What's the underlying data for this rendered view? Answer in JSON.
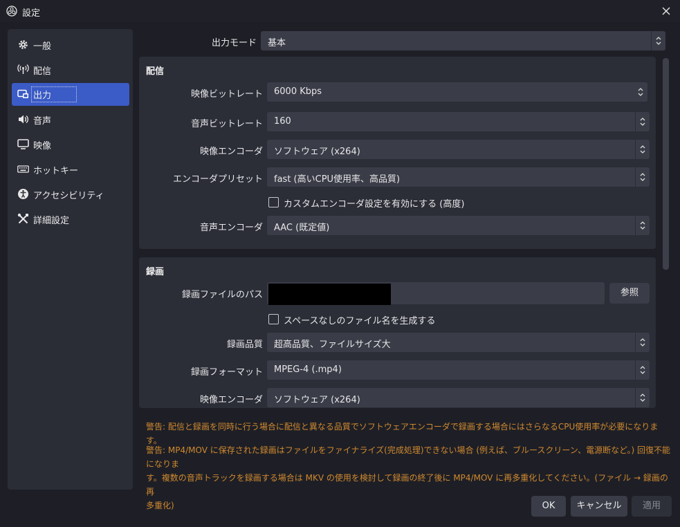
{
  "window": {
    "title": "設定"
  },
  "sidebar": {
    "items": [
      {
        "label": "一般",
        "icon": "gear-icon"
      },
      {
        "label": "配信",
        "icon": "broadcast-icon"
      },
      {
        "label": "出力",
        "icon": "output-icon"
      },
      {
        "label": "音声",
        "icon": "speaker-icon"
      },
      {
        "label": "映像",
        "icon": "monitor-icon"
      },
      {
        "label": "ホットキー",
        "icon": "keyboard-icon"
      },
      {
        "label": "アクセシビリティ",
        "icon": "accessibility-icon"
      },
      {
        "label": "詳細設定",
        "icon": "tools-icon"
      }
    ]
  },
  "output_mode": {
    "label": "出力モード",
    "value": "基本"
  },
  "streaming": {
    "title": "配信",
    "video_bitrate": {
      "label": "映像ビットレート",
      "value": "6000 Kbps"
    },
    "audio_bitrate": {
      "label": "音声ビットレート",
      "value": "160"
    },
    "video_encoder": {
      "label": "映像エンコーダ",
      "value": "ソフトウェア (x264)"
    },
    "encoder_preset": {
      "label": "エンコーダプリセット",
      "value": "fast (高いCPU使用率、高品質)"
    },
    "custom_encoder_checkbox": {
      "label": "カスタムエンコーダ設定を有効にする (高度)",
      "checked": false
    },
    "audio_encoder": {
      "label": "音声エンコーダ",
      "value": "AAC (既定値)"
    }
  },
  "recording": {
    "title": "録画",
    "path": {
      "label": "録画ファイルのパス",
      "browse_label": "参照"
    },
    "no_space_checkbox": {
      "label": "スペースなしのファイル名を生成する",
      "checked": false
    },
    "quality": {
      "label": "録画品質",
      "value": "超高品質、ファイルサイズ大"
    },
    "format": {
      "label": "録画フォーマット",
      "value": "MPEG-4 (.mp4)"
    },
    "video_encoder": {
      "label": "映像エンコーダ",
      "value": "ソフトウェア (x264)"
    }
  },
  "warnings": {
    "warning1": "警告: 配信と録画を同時に行う場合に配信と異なる品質でソフトウェアエンコーダで録画する場合にはさらなるCPU使用率が必要になります。",
    "warning2_line1": "警告: MP4/MOV に保存された録画はファイルをファイナライズ(完成処理)できない場合 (例えば、ブルースクリーン、電源断など。) 回復不能になりま",
    "warning2_line2": "す。複数の音声トラックを録画する場合は MKV の使用を検討して録画の終了後に MP4/MOV に再多重化してください。(ファイル → 録画の再",
    "warning2_line3": "多重化)"
  },
  "footer": {
    "ok_label": "OK",
    "cancel_label": "キャンセル",
    "apply_label": "適用"
  },
  "colors": {
    "accent": "#3b5bc6",
    "warning": "#d0892f",
    "background": "#1e1f26",
    "panel": "#2b2d37",
    "field": "#3a3c47"
  }
}
